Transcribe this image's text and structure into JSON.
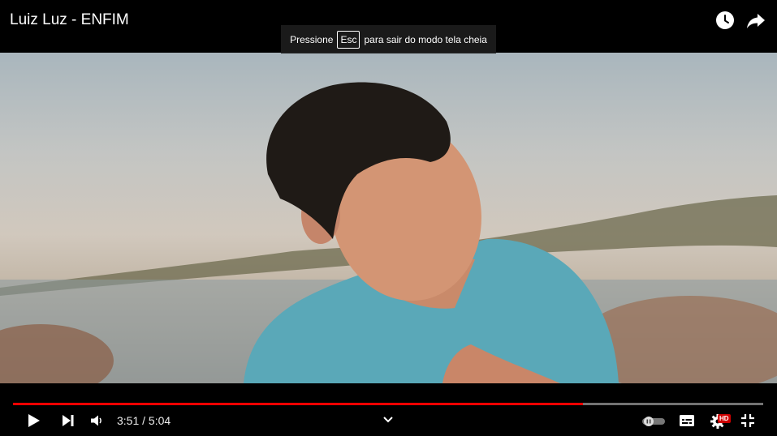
{
  "player": {
    "title": "Luiz Luz - ENFIM",
    "fullscreen_notice": {
      "before": "Pressione",
      "key": "Esc",
      "after": "para sair do modo tela cheia"
    },
    "time": {
      "current": "3:51",
      "separator": "/",
      "duration": "5:04"
    },
    "progress_fraction": 0.76,
    "quality_badge": "HD",
    "accent_color": "#ff0000",
    "icons": {
      "watch_later": "clock-icon",
      "share": "share-arrow-icon",
      "play": "play-icon",
      "next": "skip-next-icon",
      "volume": "volume-icon",
      "chevron": "chevron-down-icon",
      "autoplay": "autoplay-toggle",
      "captions": "subtitles-icon",
      "settings": "gear-icon",
      "exit_fullscreen": "exit-fullscreen-icon"
    }
  }
}
